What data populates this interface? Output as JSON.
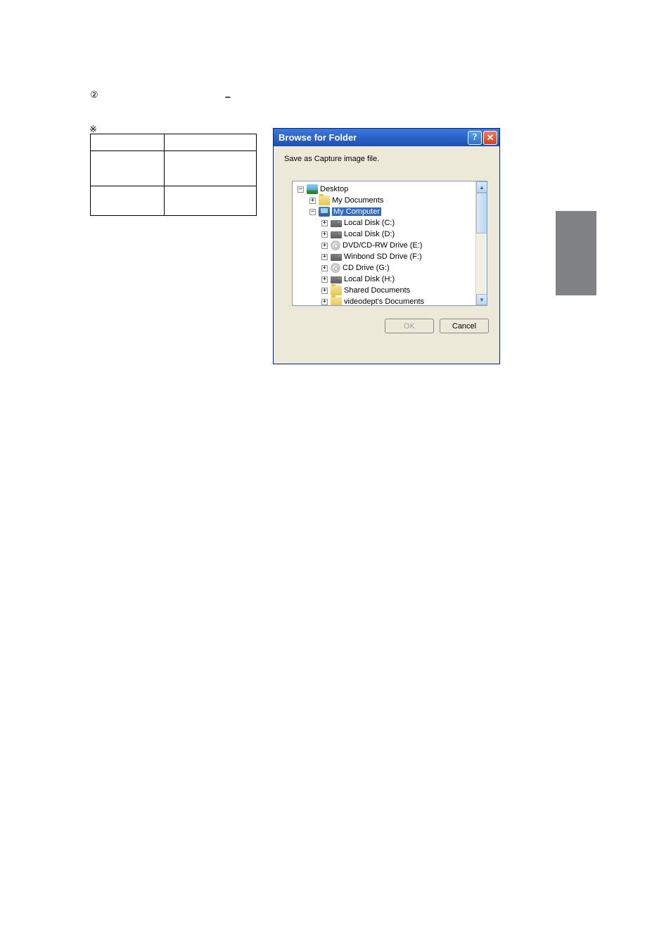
{
  "marks": {
    "circled": "②",
    "dash": "–",
    "asterisk": "※"
  },
  "dialog": {
    "title": "Browse for Folder",
    "help": "?",
    "close": "✕",
    "label": "Save as Capture image file.",
    "ok": "OK",
    "cancel": "Cancel"
  },
  "tree": {
    "desktop": "Desktop",
    "mydocs": "My Documents",
    "mycomputer": "My Computer",
    "items": [
      "Local Disk (C:)",
      "Local Disk (D:)",
      "DVD/CD-RW Drive (E:)",
      "Winbond SD Drive (F:)",
      "CD Drive (G:)",
      "Local Disk (H:)",
      "Shared Documents",
      "videodept's Documents"
    ]
  },
  "expand": {
    "plus": "+",
    "minus": "−"
  },
  "scroll": {
    "up": "▲",
    "down": "▼"
  }
}
